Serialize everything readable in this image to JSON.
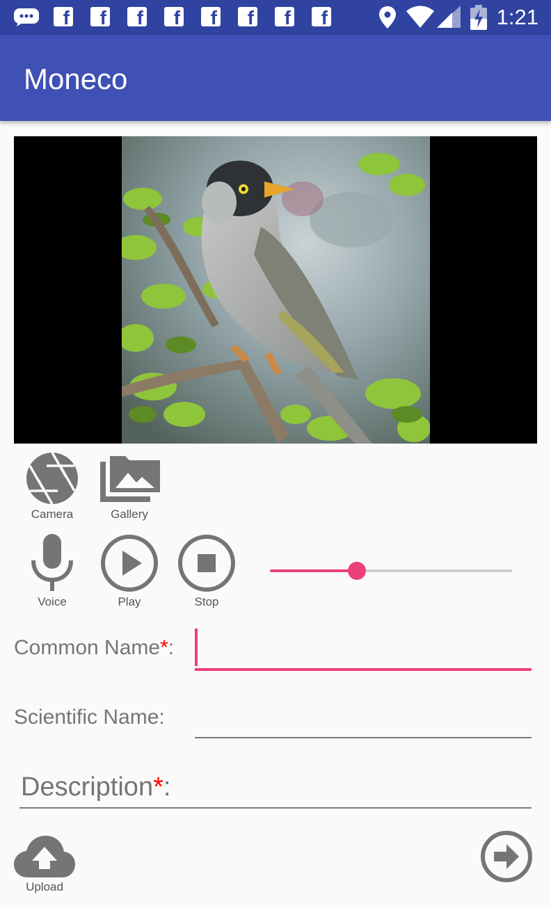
{
  "status_bar": {
    "time": "1:21",
    "icons": [
      "messenger-icon",
      "facebook-icon",
      "facebook-icon",
      "facebook-icon",
      "facebook-icon",
      "facebook-icon",
      "facebook-icon",
      "facebook-icon",
      "facebook-icon",
      "location-icon",
      "wifi-icon",
      "signal-icon",
      "battery-charging-icon"
    ],
    "facebook_glyph": "f"
  },
  "app_bar": {
    "title": "Moneco"
  },
  "photo": {
    "subject": "bird-on-branch"
  },
  "media_buttons": {
    "camera_label": "Camera",
    "gallery_label": "Gallery"
  },
  "audio_controls": {
    "voice_label": "Voice",
    "play_label": "Play",
    "stop_label": "Stop",
    "progress_fraction": 0.36
  },
  "form": {
    "common_name_label": "Common Name",
    "common_name_value": "",
    "scientific_name_label": "Scientific Name:",
    "scientific_name_value": "",
    "description_label": "Description",
    "description_value": "",
    "required_mark": "*",
    "colon": ":"
  },
  "footer": {
    "upload_label": "Upload"
  },
  "colors": {
    "status_bar": "#3043a1",
    "app_bar": "#3f51b5",
    "accent": "#ec407a",
    "icon_gray": "#757575",
    "required": "#ff0000"
  }
}
